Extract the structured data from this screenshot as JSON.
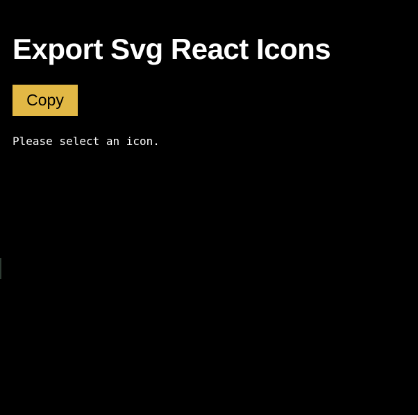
{
  "page": {
    "title": "Export Svg React Icons",
    "copy_label": "Copy",
    "status_message": "Please select an icon."
  },
  "colors": {
    "background": "#000000",
    "text": "#ffffff",
    "button_background": "#e2b845",
    "button_text": "#000000"
  }
}
